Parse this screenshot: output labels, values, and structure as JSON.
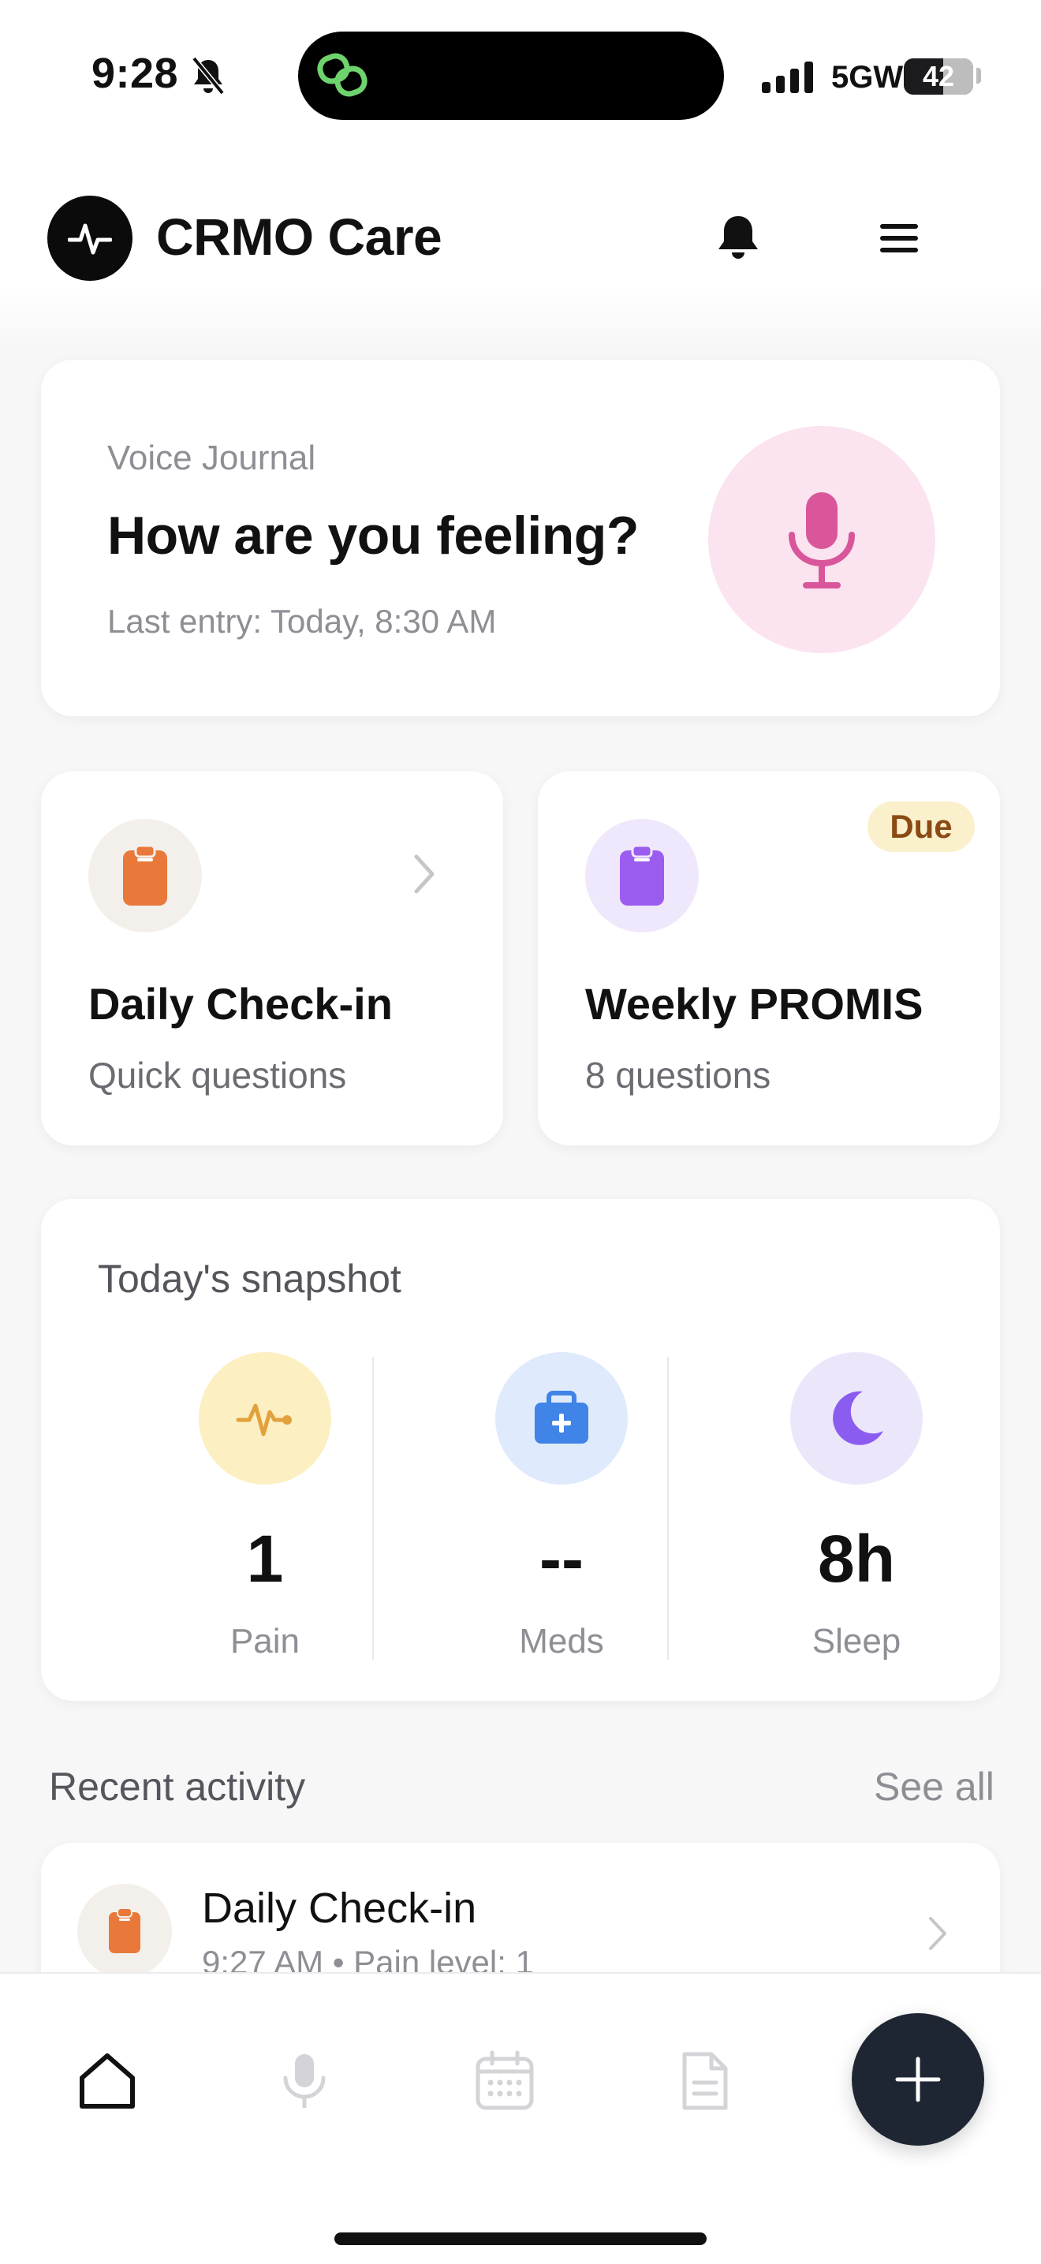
{
  "status_bar": {
    "time": "9:28",
    "network": "5GW",
    "battery": "42"
  },
  "header": {
    "title": "CRMO Care"
  },
  "voice_journal": {
    "eyebrow": "Voice Journal",
    "title": "How are you feeling?",
    "last_entry": "Last entry: Today, 8:30 AM"
  },
  "cards": {
    "daily_checkin": {
      "title": "Daily Check-in",
      "subtitle": "Quick questions"
    },
    "weekly_promis": {
      "title": "Weekly PROMIS",
      "subtitle": "8 questions",
      "badge": "Due"
    }
  },
  "snapshot": {
    "title": "Today's snapshot",
    "stats": [
      {
        "value": "1",
        "label": "Pain",
        "icon": "heartbeat-icon"
      },
      {
        "value": "--",
        "label": "Meds",
        "icon": "medkit-icon"
      },
      {
        "value": "8h",
        "label": "Sleep",
        "icon": "moon-icon"
      }
    ]
  },
  "recent": {
    "title": "Recent activity",
    "see_all": "See all",
    "items": [
      {
        "name": "Daily Check-in",
        "meta": "9:27 AM • Pain level: 1"
      }
    ]
  },
  "nav": {
    "items": [
      "home-icon",
      "microphone-icon",
      "calendar-icon",
      "document-icon"
    ],
    "fab": "plus-icon"
  },
  "colors": {
    "orange": "#e8793a",
    "purple": "#9b5cf0",
    "pink_mic": "#d9569a",
    "fab": "#1f2633"
  }
}
